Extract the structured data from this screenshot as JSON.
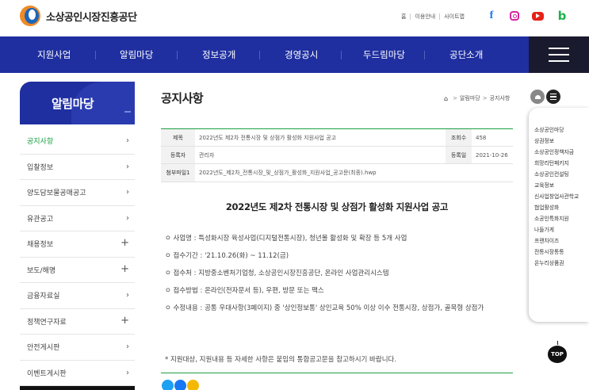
{
  "header": {
    "logo_text": "소상공인시장진흥공단",
    "util_links": [
      "홈",
      "이용안내",
      "사이트맵"
    ],
    "social": [
      "facebook-icon",
      "instagram-icon",
      "youtube-icon",
      "blog-icon"
    ],
    "blog_letter": "b",
    "facebook_letter": "f"
  },
  "nav": {
    "items": [
      "지원사업",
      "알림마당",
      "정보공개",
      "경영공시",
      "두드림마당",
      "공단소개"
    ]
  },
  "sidebar": {
    "title": "알림마당",
    "items": [
      {
        "label": "공지사항",
        "mark": "›",
        "active": true
      },
      {
        "label": "입찰정보",
        "mark": "›"
      },
      {
        "label": "양도담보물공매공고",
        "mark": "›"
      },
      {
        "label": "유관공고",
        "mark": "›"
      },
      {
        "label": "채용정보",
        "mark": "+"
      },
      {
        "label": "보도/해명",
        "mark": "+"
      },
      {
        "label": "금융자료실",
        "mark": "›"
      },
      {
        "label": "정책연구자료",
        "mark": "+"
      },
      {
        "label": "안전게시판",
        "mark": "›"
      },
      {
        "label": "이벤트게시판",
        "mark": "›"
      }
    ]
  },
  "page": {
    "title": "공지사항",
    "breadcrumb": [
      "알림마당",
      "공지사항"
    ]
  },
  "post": {
    "label_subject": "제목",
    "subject": "2022년도 제2차 전통시장 및 상점가 활성화 지원사업 공고",
    "label_views": "조회수",
    "views": "458",
    "label_author": "등록자",
    "author": "관리자",
    "label_date": "등록일",
    "date": "2021-10-26",
    "label_attach": "첨부파일1",
    "attachment": "2022년도_제2차_전통시장_및_상점가_활성화_지원사업_공고문(최종).hwp",
    "heading": "2022년도 제2차 전통시장 및 상점가 활성화 지원사업 공고",
    "bullets": [
      "ㅇ 사업명 : 특성화시장 육성사업(디지털전통시장), 청년몰 활성화 및 확장 등 5개 사업",
      "ㅇ 접수기간 : '21.10.26(화) ~ 11.12(금)",
      "ㅇ 접수처 : 지방중소벤처기업청, 소상공인시장진흥공단, 온라인 사업관리시스템",
      "ㅇ 접수방법 : 온라인(전자문서 등), 우편, 방문 또는 팩스",
      "ㅇ 수정내용 : 공통 우대사항(3페이지) 중 '상인정보통' 상인교육 50% 이상 이수 전통시장, 상점가, 골목형 상점가"
    ],
    "note": "* 지원대상, 지원내용 등 자세한 사항은 붙임의 통합공고문을 참고하시기 바랍니다."
  },
  "quick_menu": {
    "items": [
      "소상공인마당",
      "상권정보",
      "소상공인정책자금",
      "희망리턴패키지",
      "소상공인컨설팅",
      "교육정보",
      "신사업창업사관학교",
      "협업활성화",
      "소공인특화지원",
      "나들가게",
      "프랜차이즈",
      "전통시장통통",
      "온누리상품권"
    ],
    "top_label": "TOP"
  },
  "colors": {
    "nav": "#1f2fa0",
    "accent_green": "#1aa043",
    "orange": "#f08a24"
  }
}
